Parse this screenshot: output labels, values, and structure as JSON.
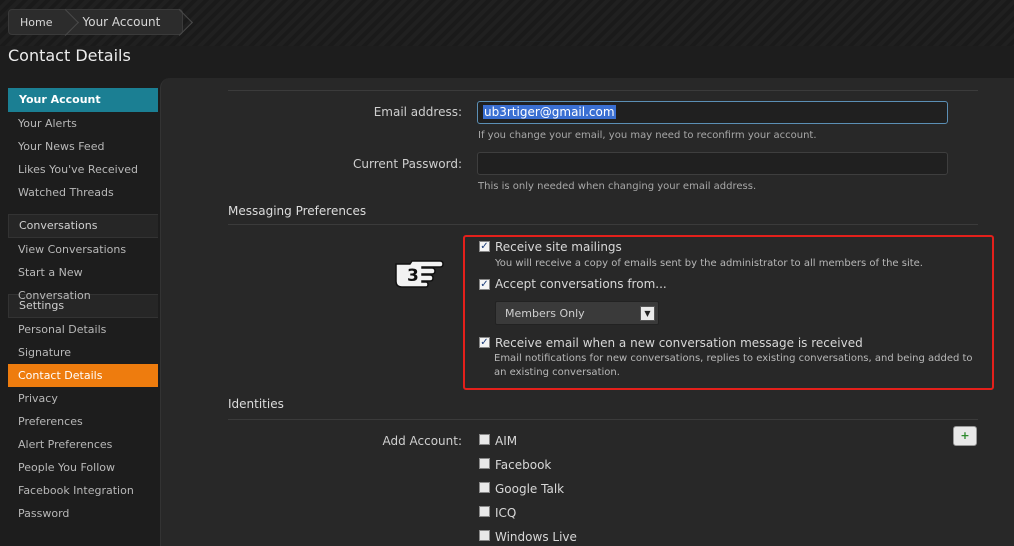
{
  "breadcrumb": {
    "items": [
      "Home",
      "Your Account"
    ]
  },
  "page_title": "Contact Details",
  "sidebar": {
    "groups": [
      {
        "title": "Your Account",
        "active": true,
        "items": [
          "Your Alerts",
          "Your News Feed",
          "Likes You've Received",
          "Watched Threads"
        ]
      },
      {
        "title": "Conversations",
        "active": false,
        "items": [
          "View Conversations",
          "Start a New Conversation"
        ]
      },
      {
        "title": "Settings",
        "active": false,
        "items": [
          "Personal Details",
          "Signature",
          "Contact Details",
          "Privacy",
          "Preferences",
          "Alert Preferences",
          "People You Follow",
          "Facebook Integration",
          "Password"
        ]
      }
    ],
    "active_item": "Contact Details"
  },
  "form": {
    "email_label": "Email address:",
    "email_value": "ub3rtiger@gmail.com",
    "email_hint": "If you change your email, you may need to reconfirm your account.",
    "password_label": "Current Password:",
    "password_value": "",
    "password_hint": "This is only needed when changing your email address."
  },
  "messaging": {
    "title": "Messaging Preferences",
    "callout_number": "3",
    "site_mailings": {
      "label": "Receive site mailings",
      "checked": true,
      "hint": "You will receive a copy of emails sent by the administrator to all members of the site."
    },
    "accept_conversations": {
      "label": "Accept conversations from...",
      "checked": true,
      "selected": "Members Only"
    },
    "email_on_message": {
      "label": "Receive email when a new conversation message is received",
      "checked": true,
      "hint_line1": "Email notifications for new conversations, replies to existing conversations, and being added to",
      "hint_line2": "an existing conversation."
    }
  },
  "identities": {
    "title": "Identities",
    "add_label": "Add Account:",
    "accounts": [
      "AIM",
      "Facebook",
      "Google Talk",
      "ICQ",
      "Windows Live"
    ],
    "add_button": "+"
  },
  "colors": {
    "accent_teal": "#1b7f93",
    "accent_orange": "#ee7c0e",
    "highlight_red": "#e3201b"
  }
}
